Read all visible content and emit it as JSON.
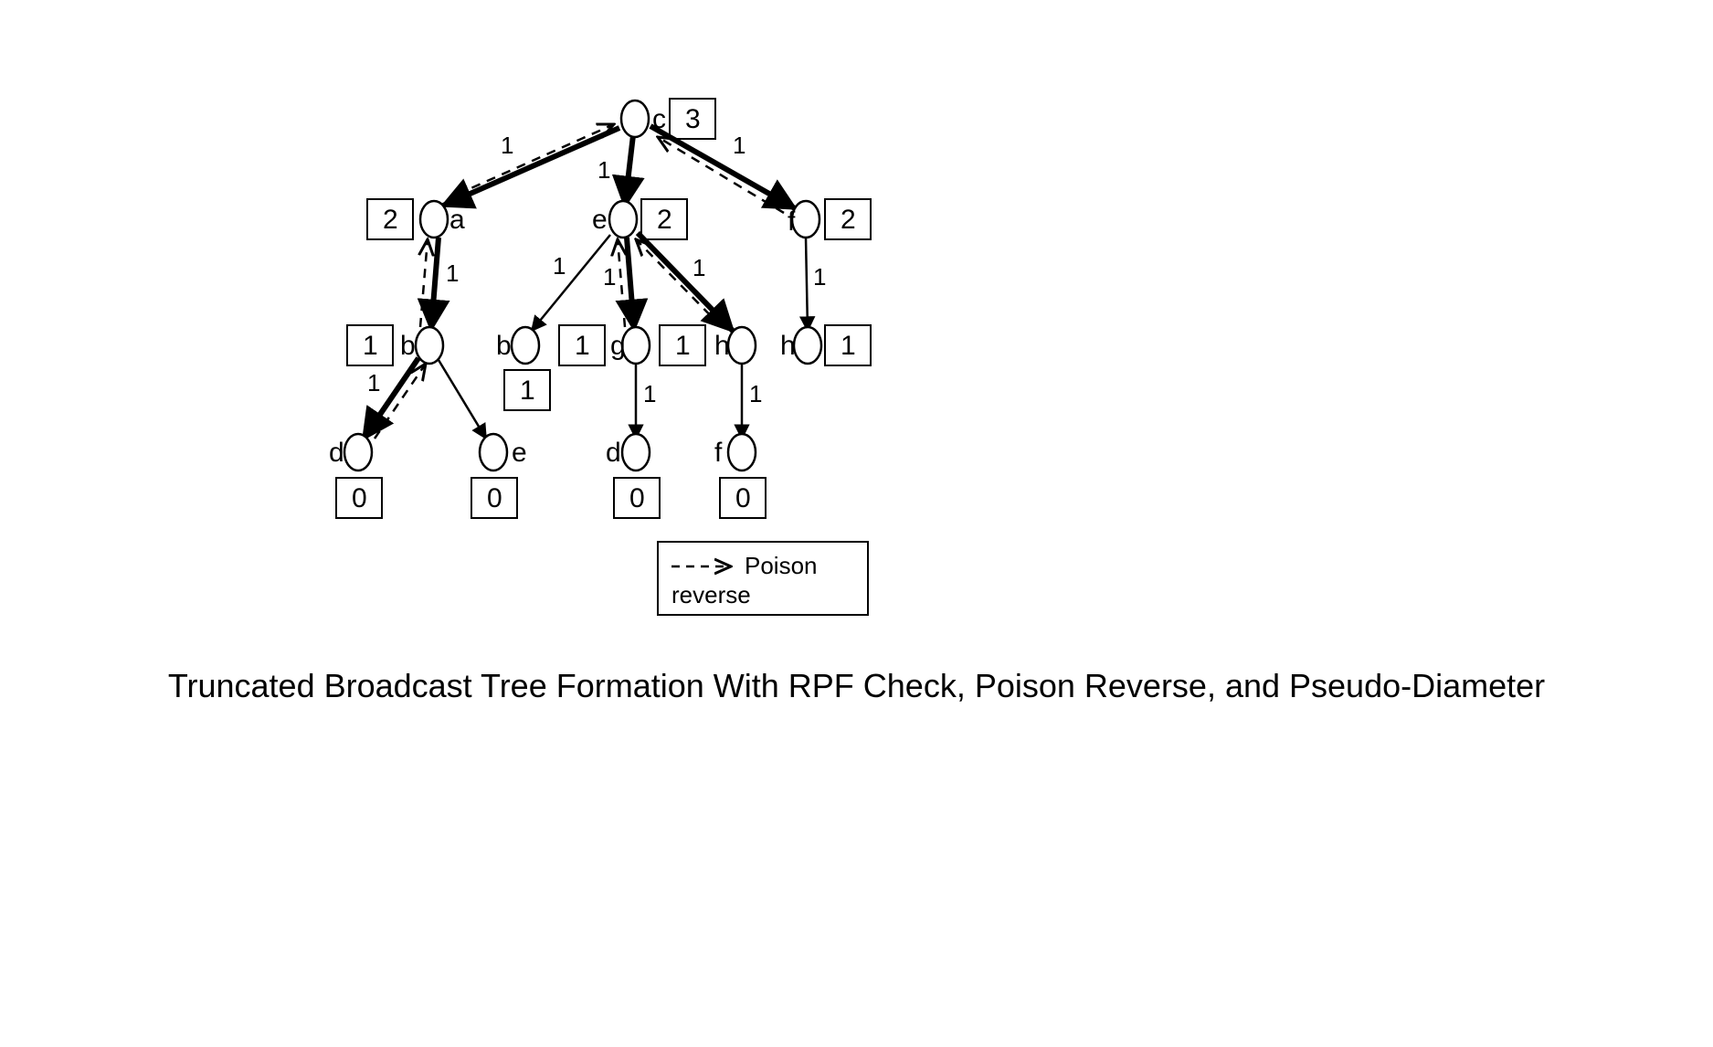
{
  "caption": "Truncated Broadcast Tree Formation With RPF Check, Poison Reverse, and Pseudo-Diameter",
  "legend": {
    "text": "Poison reverse"
  },
  "nodes": {
    "c": {
      "label": "c",
      "value": "3"
    },
    "a": {
      "label": "a",
      "value": "2"
    },
    "e1": {
      "label": "e",
      "value": "2"
    },
    "f1": {
      "label": "f",
      "value": "2"
    },
    "b1": {
      "label": "b",
      "value": "1"
    },
    "b2": {
      "label": "b",
      "value": "1"
    },
    "g": {
      "label": "g",
      "value": "1"
    },
    "h1": {
      "label": "h",
      "value": "1"
    },
    "h2": {
      "label": "h",
      "value": "1"
    },
    "d1": {
      "label": "d",
      "value": "0"
    },
    "e2": {
      "label": "e",
      "value": "0"
    },
    "d2": {
      "label": "d",
      "value": "0"
    },
    "f2": {
      "label": "f",
      "value": "0"
    }
  },
  "edges": {
    "c_a": {
      "weight": "1",
      "thick": true,
      "poison": true
    },
    "c_e": {
      "weight": "1",
      "thick": true,
      "poison": false
    },
    "c_f": {
      "weight": "1",
      "thick": true,
      "poison": true
    },
    "a_b": {
      "weight": "1",
      "thick": true,
      "poison": true
    },
    "e_b": {
      "weight": "1",
      "thick": false,
      "poison": false
    },
    "e_g": {
      "weight": "1",
      "thick": true,
      "poison": true
    },
    "e_h": {
      "weight": "1",
      "thick": true,
      "poison": true
    },
    "f_h": {
      "weight": "1",
      "thick": false,
      "poison": false
    },
    "b_d": {
      "weight": "1",
      "thick": true,
      "poison": true
    },
    "b_e": {
      "weight": "",
      "thick": false,
      "poison": false
    },
    "g_d": {
      "weight": "1",
      "thick": false,
      "poison": false
    },
    "h_f": {
      "weight": "1",
      "thick": false,
      "poison": false
    }
  }
}
